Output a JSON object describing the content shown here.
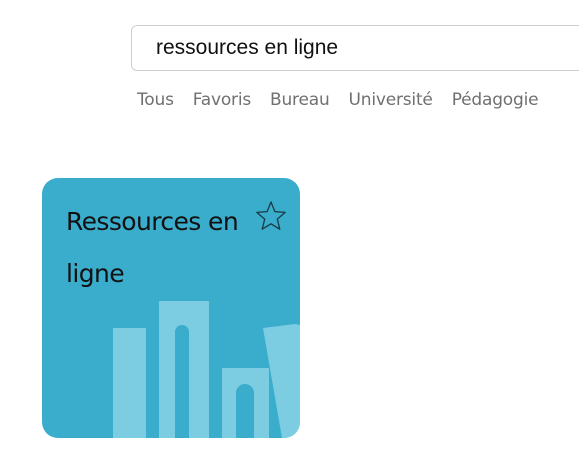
{
  "search": {
    "value": "ressources en ligne"
  },
  "filters": [
    "Tous",
    "Favoris",
    "Bureau",
    "Université",
    "Pédagogie"
  ],
  "tile": {
    "title": "Ressources en ligne",
    "favorite_icon": "star-outline-icon",
    "illustration_icon": "books-icon",
    "background_color": "#3aaccc",
    "accent_color": "#7ccde2"
  }
}
